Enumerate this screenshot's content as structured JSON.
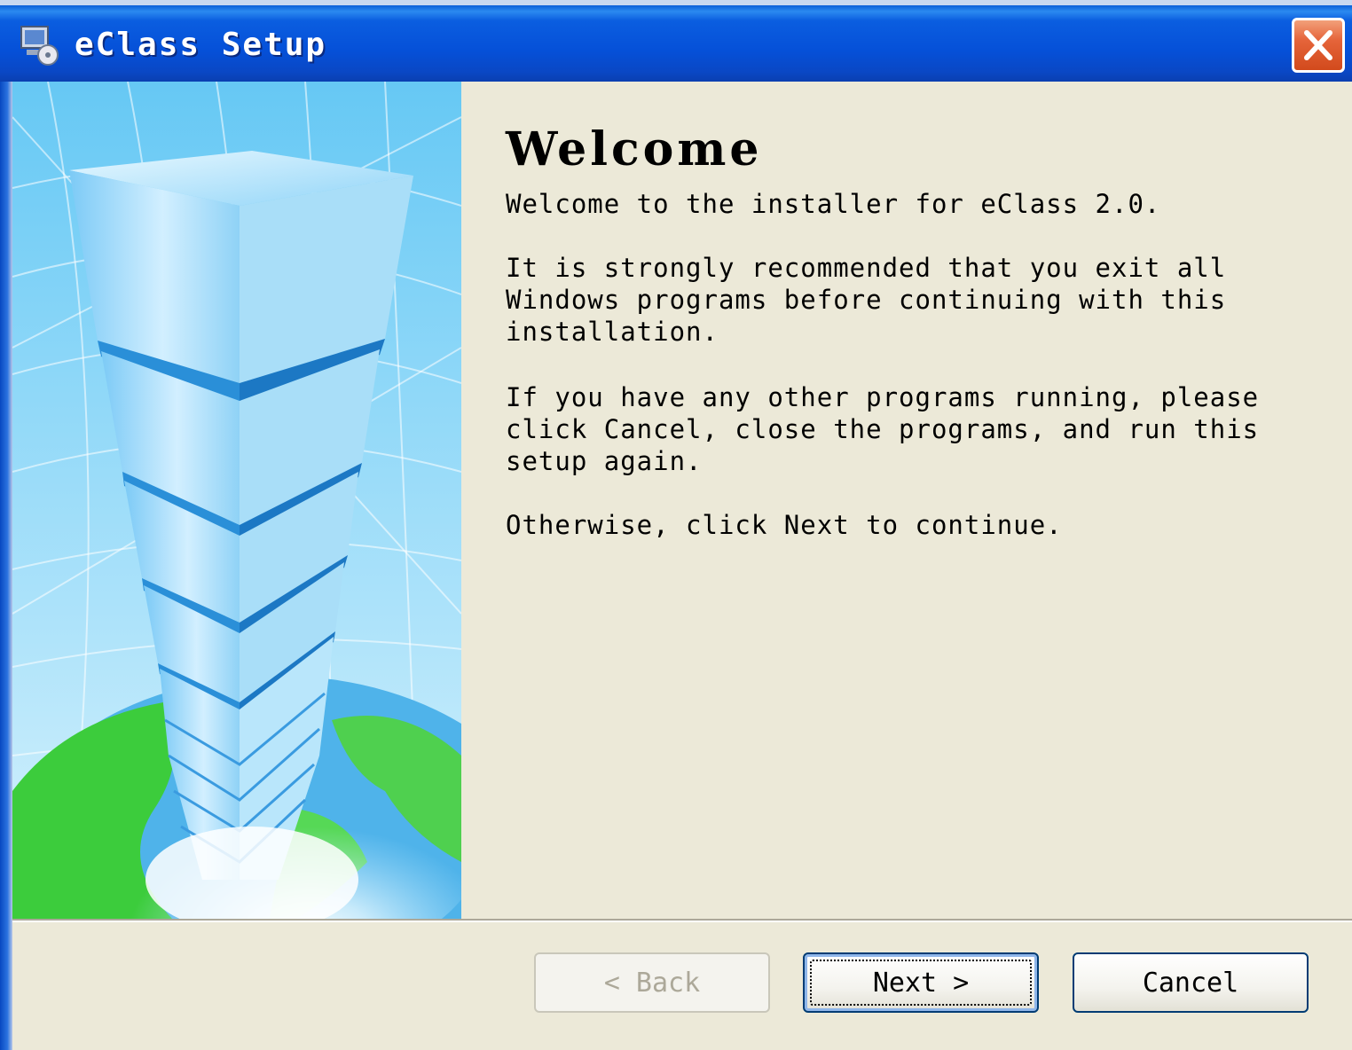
{
  "window": {
    "title": "eClass Setup"
  },
  "content": {
    "heading": "Welcome",
    "paragraph1": "Welcome to the installer for eClass 2.0.",
    "paragraph2": "It is strongly recommended that you exit all\nWindows programs before continuing with this\ninstallation.",
    "paragraph3": "If you have any other programs running, please\nclick Cancel, close the programs, and run this\nsetup again.",
    "paragraph4": "Otherwise, click Next to continue."
  },
  "buttons": {
    "back": {
      "label": "< Back",
      "enabled": false
    },
    "next": {
      "label": "Next >",
      "enabled": true,
      "focused": true
    },
    "cancel": {
      "label": "Cancel",
      "enabled": true
    }
  },
  "colors": {
    "titlebar": "#0550d8",
    "dialog_bg": "#ece9d8",
    "close_button": "#e5643a",
    "button_border": "#003c74"
  },
  "icons": {
    "app": "setup-computer-icon",
    "close": "close-icon"
  }
}
